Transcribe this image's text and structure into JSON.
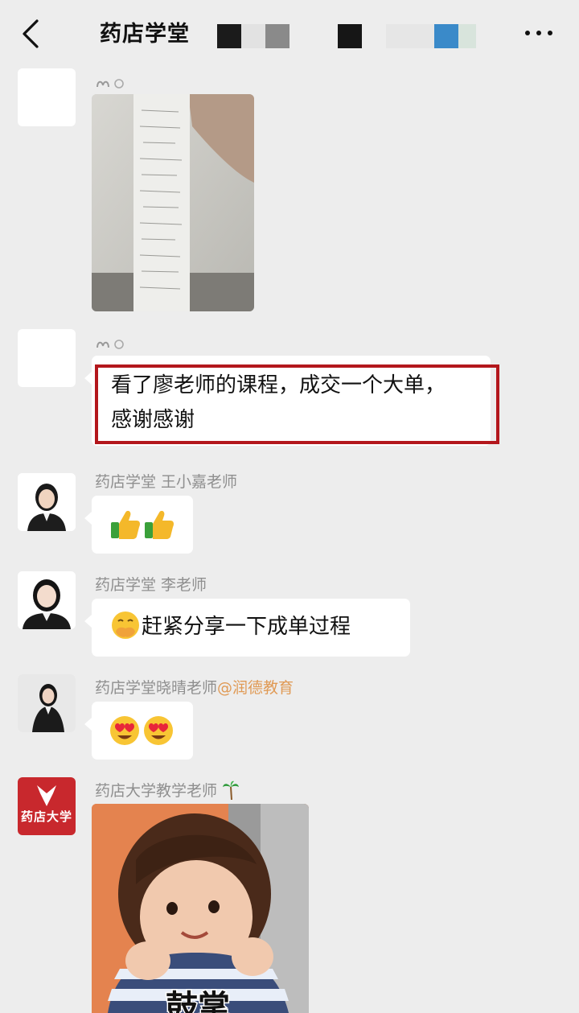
{
  "header": {
    "title": "药店学堂",
    "back_icon": "chevron-left-icon",
    "more_icon": "ellipsis-icon"
  },
  "messages": [
    {
      "type": "image",
      "description_icon": "receipt-photo"
    },
    {
      "type": "text",
      "text_line1": "看了廖老师的课程，成交一个大单，",
      "text_line2": "感谢感谢",
      "highlight_color": "#b3171c"
    },
    {
      "type": "emoji",
      "sender": "药店学堂 王小嘉老师",
      "emoji": "thumbs-up-icon x2"
    },
    {
      "type": "text",
      "sender": "药店学堂 李老师",
      "text": "赶紧分享一下成单过程",
      "emoji": "hand-over-mouth-icon"
    },
    {
      "type": "emoji",
      "sender_name": "药店学堂晓晴老师",
      "sender_mention": "@润德教育",
      "emoji": "heart-eyes-icon x2"
    },
    {
      "type": "image",
      "sender": "药店大学教学老师",
      "sender_badge": "palm-tree-icon",
      "avatar_text": "药店大学",
      "sticker_caption": "鼓掌"
    }
  ],
  "colors": {
    "background": "#ededed",
    "bubble": "#ffffff",
    "highlight": "#b3171c",
    "mention": "#e09a55",
    "brand_avatar": "#c8282d"
  }
}
